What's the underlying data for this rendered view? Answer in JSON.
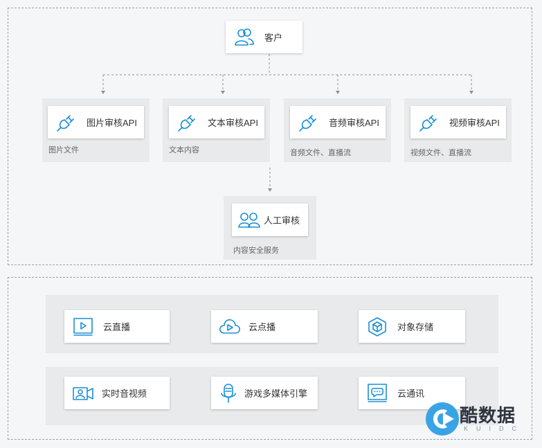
{
  "top": {
    "client": {
      "label": "客户"
    },
    "apis": [
      {
        "label": "图片审核API",
        "sub": "图片文件"
      },
      {
        "label": "文本审核API",
        "sub": "文本内容"
      },
      {
        "label": "音频审核API",
        "sub": "音频文件、直播流"
      },
      {
        "label": "视频审核API",
        "sub": "视频文件、直播流"
      }
    ],
    "manual": {
      "label": "人工审核",
      "sub": "内容安全服务"
    }
  },
  "bottom": {
    "row1": [
      {
        "label": "云直播",
        "icon": "live-icon"
      },
      {
        "label": "云点播",
        "icon": "cloud-play-icon"
      },
      {
        "label": "对象存储",
        "icon": "cube-icon"
      }
    ],
    "row2": [
      {
        "label": "实时音视频",
        "icon": "video-camera-icon"
      },
      {
        "label": "游戏多媒体引擎",
        "icon": "microphone-icon"
      },
      {
        "label": "云通讯",
        "icon": "chat-monitor-icon"
      }
    ]
  },
  "watermark": {
    "title": "酷数据",
    "sub": "KUIDC"
  },
  "colors": {
    "accent": "#1a8fd6",
    "group_bg": "#e9eaec",
    "page_bg": "#f5f6f8"
  }
}
